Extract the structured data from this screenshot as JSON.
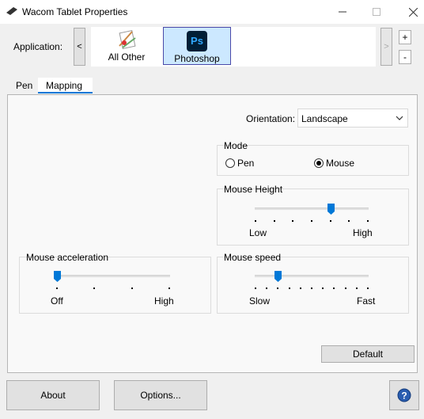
{
  "window": {
    "title": "Wacom Tablet Properties",
    "minimize_icon": "minimize-icon",
    "maximize_icon": "maximize-icon",
    "close_icon": "close-icon"
  },
  "application": {
    "label": "Application:",
    "prev_arrow": "<",
    "next_arrow": ">",
    "add_symbol": "+",
    "remove_symbol": "-",
    "items": [
      {
        "label": "All Other",
        "icon": "all-other-apps-icon",
        "selected": false
      },
      {
        "label": "Photoshop",
        "icon": "photoshop-icon",
        "icon_text": "Ps",
        "selected": true
      }
    ]
  },
  "tabs": [
    {
      "label": "Pen",
      "active": false
    },
    {
      "label": "Mapping",
      "active": true
    }
  ],
  "orientation": {
    "label": "Orientation:",
    "value": "Landscape"
  },
  "mode": {
    "title": "Mode",
    "options": [
      {
        "label": "Pen",
        "selected": false
      },
      {
        "label": "Mouse",
        "selected": true
      }
    ]
  },
  "mouse_height": {
    "title": "Mouse Height",
    "min_label": "Low",
    "max_label": "High",
    "tick_count": 7,
    "value_tick": 4
  },
  "mouse_acceleration": {
    "title": "Mouse acceleration",
    "min_label": "Off",
    "max_label": "High",
    "tick_count": 4,
    "value_tick": 0
  },
  "mouse_speed": {
    "title": "Mouse speed",
    "min_label": "Slow",
    "max_label": "Fast",
    "tick_count": 11,
    "value_tick": 2
  },
  "buttons": {
    "default": "Default",
    "about": "About",
    "options": "Options...",
    "help_icon": "help-icon"
  },
  "colors": {
    "accent": "#0078d7",
    "selected_bg": "#cce8ff",
    "ps_blue": "#31a8ff",
    "ps_bg": "#001e36"
  }
}
